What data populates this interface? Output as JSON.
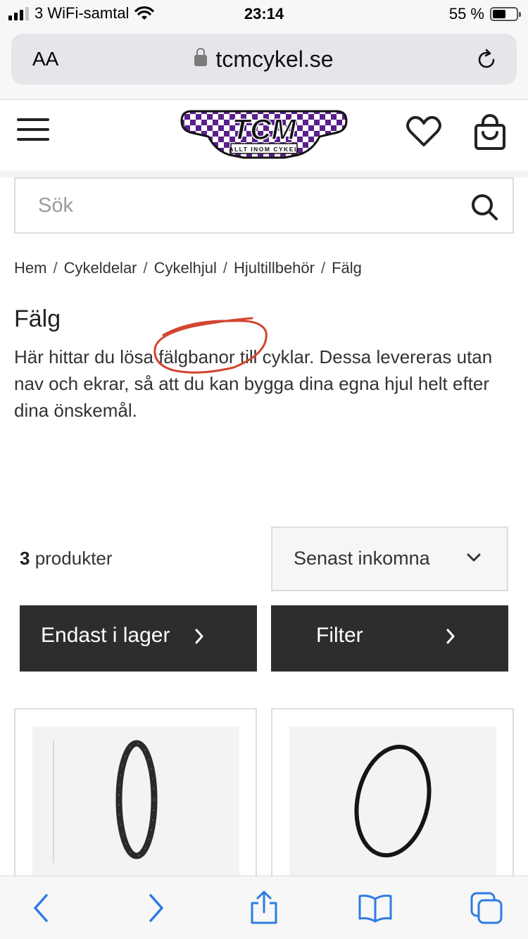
{
  "status_bar": {
    "carrier": "3 WiFi-samtal",
    "time": "23:14",
    "battery": "55 %",
    "battery_level": 0.55
  },
  "browser": {
    "aa_label": "AA",
    "url": "tcmcykel.se"
  },
  "header": {
    "logo_text": "TCM",
    "logo_tagline": "ALLT INOM CYKEL"
  },
  "search": {
    "placeholder": "Sök"
  },
  "breadcrumb": [
    "Hem",
    "Cykeldelar",
    "Cykelhjul",
    "Hjultillbehör",
    "Fälg"
  ],
  "page": {
    "title": "Fälg",
    "description": "Här hittar du lösa fälgbanor till cyklar. Dessa levereras utan nav och ekrar, så att du kan bygga dina egna hjul helt efter dina önskemål."
  },
  "products": {
    "count_number": "3",
    "count_suffix": " produkter",
    "sort_selected": "Senast inkomna",
    "stock_button": "Endast i lager",
    "filter_button": "Filter"
  },
  "colors": {
    "dark_button": "#2d2d30",
    "ios_blue": "#2f7ce0",
    "annotation_red": "#d2452f",
    "logo_purple": "#5a1f8c"
  },
  "icons": [
    "hamburger-icon",
    "heart-icon",
    "cart-icon",
    "search-icon",
    "reload-icon",
    "lock-icon",
    "back-icon",
    "forward-icon",
    "share-icon",
    "bookmarks-icon",
    "tabs-icon"
  ]
}
